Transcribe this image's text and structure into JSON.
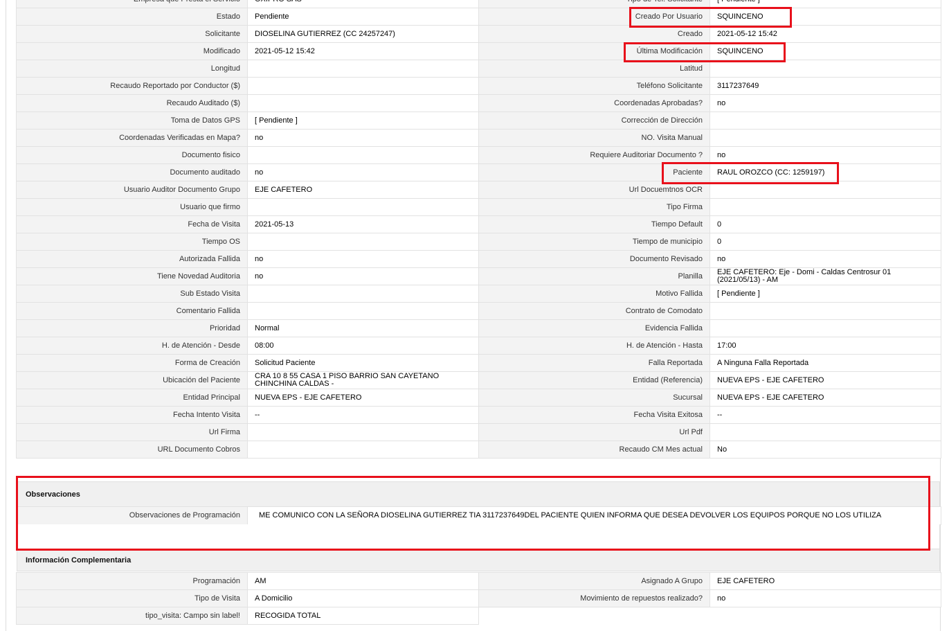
{
  "main_rows": [
    {
      "l1": "Empresa que Presta el Servicio",
      "v1": "OXIPRO SAS",
      "l2": "Tipo de Tel. Solicitante",
      "v2": "[ Pendiente ]"
    },
    {
      "l1": "Estado",
      "v1": "Pendiente",
      "l2": "Creado Por Usuario",
      "v2": "SQUINCENO"
    },
    {
      "l1": "Solicitante",
      "v1": "DIOSELINA GUTIERREZ (CC 24257247)",
      "l2": "Creado",
      "v2": "2021-05-12 15:42"
    },
    {
      "l1": "Modificado",
      "v1": "2021-05-12 15:42",
      "l2": "Última Modificación",
      "v2": " SQUINCENO"
    },
    {
      "l1": "Longitud",
      "v1": "",
      "l2": "Latitud",
      "v2": ""
    },
    {
      "l1": "Recaudo Reportado por Conductor ($)",
      "v1": "",
      "l2": "Teléfono Solicitante",
      "v2": "3117237649"
    },
    {
      "l1": "Recaudo Auditado ($)",
      "v1": "",
      "l2": "Coordenadas Aprobadas?",
      "v2": " no"
    },
    {
      "l1": "Toma de Datos GPS",
      "v1": "[ Pendiente ]",
      "l2": "Corrección de Dirección",
      "v2": ""
    },
    {
      "l1": "Coordenadas Verificadas en Mapa?",
      "v1": " no",
      "l2": "NO. Visita Manual",
      "v2": ""
    },
    {
      "l1": "Documento fisico",
      "v1": "",
      "l2": "Requiere Auditoriar Documento ?",
      "v2": " no"
    },
    {
      "l1": "Documento auditado",
      "v1": " no",
      "l2": "Paciente",
      "v2": "RAUL OROZCO (CC: 1259197)"
    },
    {
      "l1": "Usuario Auditor Documento Grupo",
      "v1": "EJE CAFETERO",
      "l2": "Url Docuemtnos OCR",
      "v2": ""
    },
    {
      "l1": "Usuario que firmo",
      "v1": "",
      "l2": "Tipo Firma",
      "v2": ""
    },
    {
      "l1": "Fecha de Visita",
      "v1": " 2021-05-13",
      "l2": "Tiempo Default",
      "v2": "0"
    },
    {
      "l1": "Tiempo OS",
      "v1": "",
      "l2": "Tiempo de municipio",
      "v2": "0"
    },
    {
      "l1": "Autorizada Fallida",
      "v1": " no",
      "l2": "Documento Revisado",
      "v2": " no"
    },
    {
      "l1": "Tiene Novedad Auditoria",
      "v1": " no",
      "l2": "Planilla",
      "v2": "EJE CAFETERO: Eje - Domi - Caldas Centrosur 01 (2021/05/13) - AM"
    },
    {
      "l1": "Sub Estado Visita",
      "v1": "",
      "l2": "Motivo Fallida",
      "v2": "[ Pendiente ]"
    },
    {
      "l1": "Comentario Fallida",
      "v1": "",
      "l2": "Contrato de Comodato",
      "v2": ""
    },
    {
      "l1": "Prioridad",
      "v1": "Normal",
      "l2": "Evidencia Fallida",
      "v2": ""
    },
    {
      "l1": "H. de Atención - Desde",
      "v1": "08:00",
      "l2": "H. de Atención - Hasta",
      "v2": "17:00"
    },
    {
      "l1": "Forma de Creación",
      "v1": "Solicitud Paciente",
      "l2": "Falla Reportada",
      "v2": "A Ninguna Falla Reportada"
    },
    {
      "l1": "Ubicación del Paciente",
      "v1": "CRA 10 8 55 CASA 1 PISO BARRIO SAN CAYETANO CHINCHINA CALDAS -",
      "l2": "Entidad (Referencia)",
      "v2": "NUEVA EPS - EJE CAFETERO"
    },
    {
      "l1": "Entidad Principal",
      "v1": "NUEVA EPS - EJE CAFETERO",
      "l2": "Sucursal",
      "v2": "NUEVA EPS - EJE CAFETERO"
    },
    {
      "l1": "Fecha Intento Visita",
      "v1": " --",
      "l2": "Fecha Visita Exitosa",
      "v2": " --"
    },
    {
      "l1": "Url Firma",
      "v1": "",
      "l2": "Url Pdf",
      "v2": ""
    },
    {
      "l1": "URL Documento Cobros",
      "v1": "",
      "l2": "Recaudo CM Mes actual",
      "v2": " No"
    }
  ],
  "observaciones": {
    "title": "Observaciones",
    "label": "Observaciones de Programación",
    "value": "ME COMUNICO CON LA SEÑORA DIOSELINA GUTIERREZ TIA 3117237649DEL PACIENTE QUIEN INFORMA QUE DESEA DEVOLVER LOS EQUIPOS PORQUE NO LOS UTILIZA"
  },
  "complementaria": {
    "title": "Información Complementaria",
    "rows": [
      {
        "l1": "Programación",
        "v1": "AM",
        "l2": "Asignado A Grupo",
        "v2": "EJE CAFETERO"
      },
      {
        "l1": "Tipo de Visita",
        "v1": "A Domicilio",
        "l2": "Movimiento de repuestos realizado?",
        "v2": " no"
      },
      {
        "l1": "tipo_visita: Campo sin label!",
        "v1": "RECOGIDA TOTAL",
        "l2": "",
        "v2": ""
      }
    ]
  },
  "highlight_color": "#e8101b"
}
